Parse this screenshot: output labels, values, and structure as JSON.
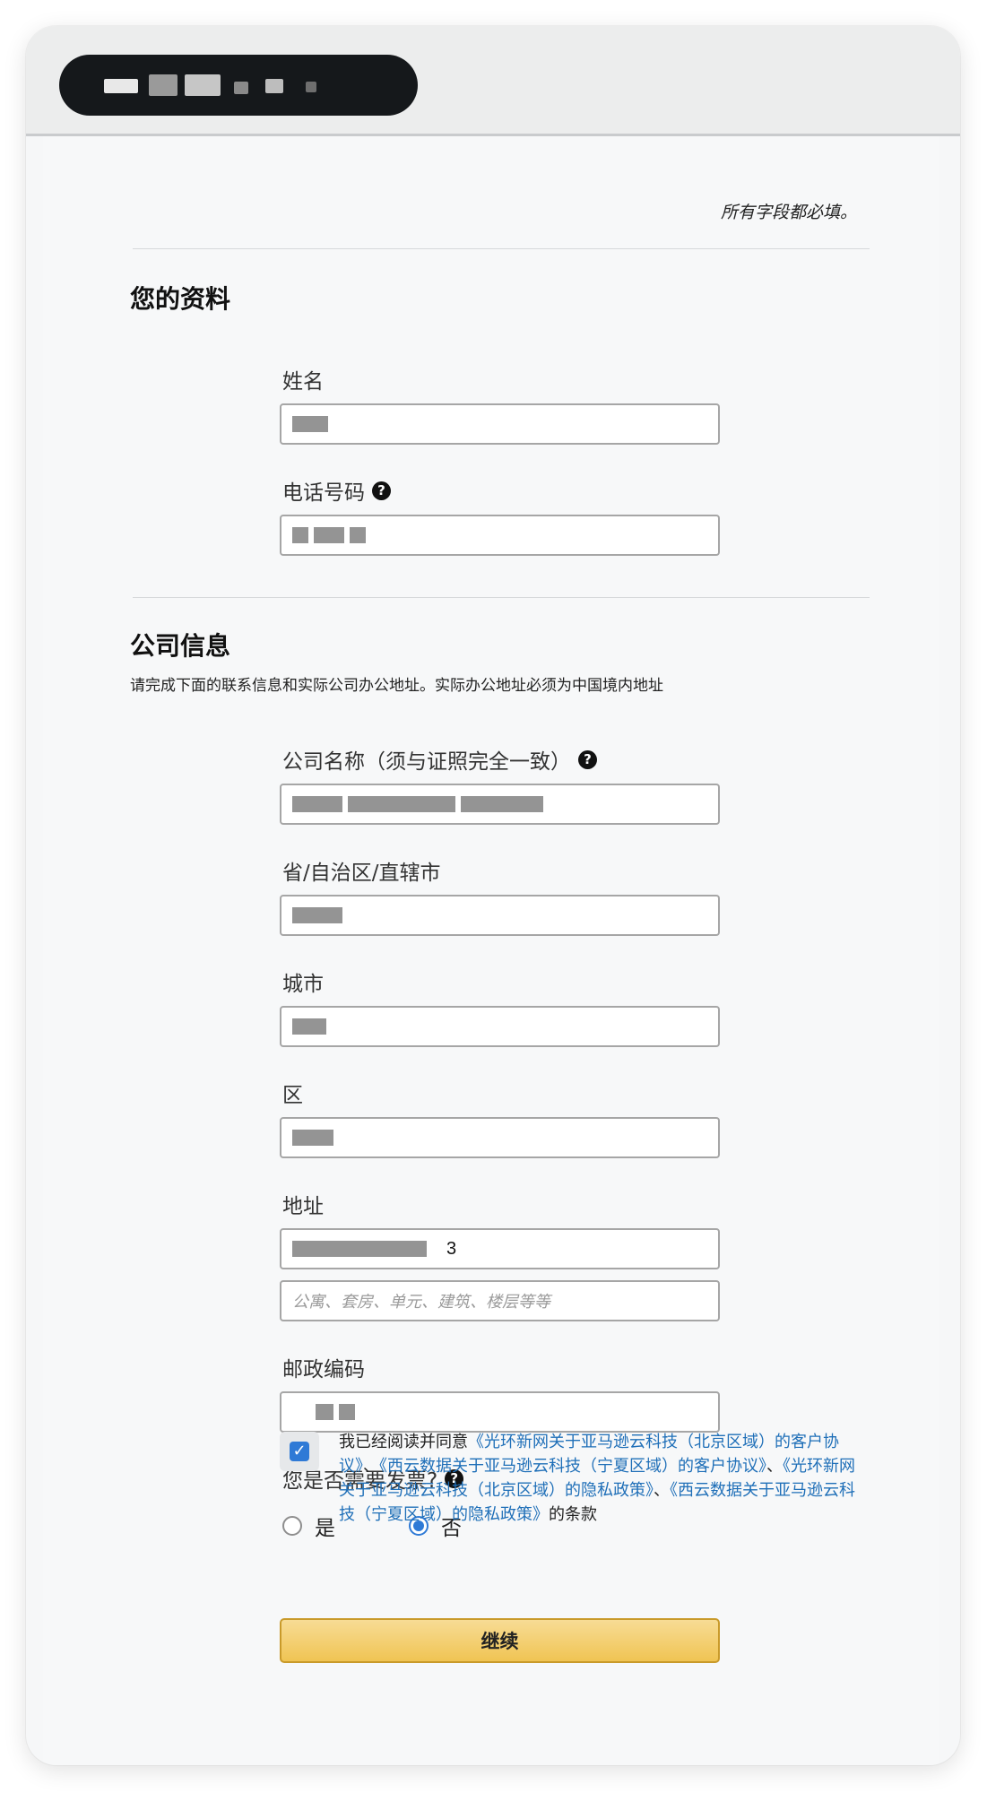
{
  "header": {
    "required_note": "所有字段都必填。"
  },
  "profile": {
    "title": "您的资料",
    "name_label": "姓名",
    "phone_label": "电话号码"
  },
  "company": {
    "title": "公司信息",
    "description": "请完成下面的联系信息和实际公司办公地址。实际办公地址必须为中国境内地址",
    "name_label": "公司名称（须与证照完全一致）",
    "province_label": "省/自治区/直辖市",
    "city_label": "城市",
    "district_label": "区",
    "address_label": "地址",
    "address_line1_suffix": "3",
    "address_line2_placeholder": "公寓、套房、单元、建筑、楼层等等",
    "postal_label": "邮政编码",
    "invoice_label": "您是否需要发票?",
    "invoice_yes": "是",
    "invoice_no": "否",
    "invoice_selected": "否"
  },
  "agreement": {
    "prefix": "我已经阅读并同意",
    "link1": "《光环新网关于亚马逊云科技（北京区域）的客户协议》",
    "sep1": "、",
    "link2": "《西云数据关于亚马逊云科技（宁夏区域）的客户协议》",
    "sep2": "、",
    "link3": "《光环新网关于亚马逊云科技（北京区域）的隐私政策》",
    "sep3": "、",
    "link4": "《西云数据关于亚马逊云科技（宁夏区域）的隐私政策》",
    "suffix": "的条款",
    "checked": true
  },
  "actions": {
    "continue_label": "继续"
  },
  "colors": {
    "accent": "#2f7ad6",
    "link": "#1f6fb8",
    "button": "#f0c453"
  },
  "icons": {
    "help": "question-circle-icon",
    "check": "checkmark-icon"
  }
}
